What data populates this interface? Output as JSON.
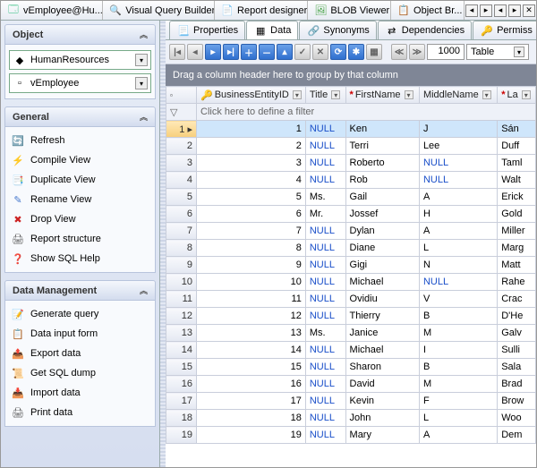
{
  "top_tabs": [
    {
      "label": "vEmployee@Hu...",
      "icon": "🗔",
      "color": "#2b7"
    },
    {
      "label": "Visual Query Builder",
      "icon": "🔍",
      "color": "#36c"
    },
    {
      "label": "Report designer",
      "icon": "📄",
      "color": "#c63"
    },
    {
      "label": "BLOB Viewer",
      "icon": "🖼",
      "color": "#393"
    },
    {
      "label": "Object Br...",
      "icon": "📋",
      "color": "#36c"
    }
  ],
  "object_panel": {
    "title": "Object",
    "schema": "HumanResources",
    "view": "vEmployee"
  },
  "general_panel": {
    "title": "General",
    "items": [
      {
        "label": "Refresh",
        "icon": "🔄",
        "color": "#3a7"
      },
      {
        "label": "Compile View",
        "icon": "⚡",
        "color": "#c80"
      },
      {
        "label": "Duplicate View",
        "icon": "📑",
        "color": "#47c"
      },
      {
        "label": "Rename View",
        "icon": "✎",
        "color": "#47c"
      },
      {
        "label": "Drop View",
        "icon": "✖",
        "color": "#c22"
      },
      {
        "label": "Report structure",
        "icon": "🖨",
        "color": "#555"
      },
      {
        "label": "Show SQL Help",
        "icon": "❓",
        "color": "#27c"
      }
    ]
  },
  "data_mgmt_panel": {
    "title": "Data Management",
    "items": [
      {
        "label": "Generate query",
        "icon": "📝",
        "color": "#c80"
      },
      {
        "label": "Data input form",
        "icon": "📋",
        "color": "#47c"
      },
      {
        "label": "Export data",
        "icon": "📤",
        "color": "#3a7"
      },
      {
        "label": "Get SQL dump",
        "icon": "📜",
        "color": "#47c"
      },
      {
        "label": "Import data",
        "icon": "📥",
        "color": "#c44"
      },
      {
        "label": "Print data",
        "icon": "🖨",
        "color": "#555"
      }
    ]
  },
  "sub_tabs": [
    {
      "label": "Properties",
      "icon": "📃"
    },
    {
      "label": "Data",
      "icon": "▦",
      "active": true
    },
    {
      "label": "Synonyms",
      "icon": "🔗"
    },
    {
      "label": "Dependencies",
      "icon": "⇄"
    },
    {
      "label": "Permiss",
      "icon": "🔑"
    }
  ],
  "toolbar": {
    "page_value": "1000",
    "view_mode": "Table"
  },
  "group_hint": "Drag a column header here to group by that column",
  "filter_hint": "Click here to define a filter",
  "columns": [
    {
      "label": "BusinessEntityID",
      "key": true
    },
    {
      "label": "Title",
      "star": false
    },
    {
      "label": "FirstName",
      "star": true
    },
    {
      "label": "MiddleName",
      "star": false
    },
    {
      "label": "La",
      "star": true
    }
  ],
  "rows": [
    {
      "n": 1,
      "id": 1,
      "title": null,
      "first": "Ken",
      "mid": "J",
      "last": "Sán",
      "sel": true
    },
    {
      "n": 2,
      "id": 2,
      "title": null,
      "first": "Terri",
      "mid": "Lee",
      "last": "Duff"
    },
    {
      "n": 3,
      "id": 3,
      "title": null,
      "first": "Roberto",
      "mid": null,
      "last": "Taml"
    },
    {
      "n": 4,
      "id": 4,
      "title": null,
      "first": "Rob",
      "mid": null,
      "last": "Walt"
    },
    {
      "n": 5,
      "id": 5,
      "title": "Ms.",
      "first": "Gail",
      "mid": "A",
      "last": "Erick"
    },
    {
      "n": 6,
      "id": 6,
      "title": "Mr.",
      "first": "Jossef",
      "mid": "H",
      "last": "Gold"
    },
    {
      "n": 7,
      "id": 7,
      "title": null,
      "first": "Dylan",
      "mid": "A",
      "last": "Miller"
    },
    {
      "n": 8,
      "id": 8,
      "title": null,
      "first": "Diane",
      "mid": "L",
      "last": "Marg"
    },
    {
      "n": 9,
      "id": 9,
      "title": null,
      "first": "Gigi",
      "mid": "N",
      "last": "Matt"
    },
    {
      "n": 10,
      "id": 10,
      "title": null,
      "first": "Michael",
      "mid": null,
      "last": "Rahe"
    },
    {
      "n": 11,
      "id": 11,
      "title": null,
      "first": "Ovidiu",
      "mid": "V",
      "last": "Crac"
    },
    {
      "n": 12,
      "id": 12,
      "title": null,
      "first": "Thierry",
      "mid": "B",
      "last": "D'He"
    },
    {
      "n": 13,
      "id": 13,
      "title": "Ms.",
      "first": "Janice",
      "mid": "M",
      "last": "Galv"
    },
    {
      "n": 14,
      "id": 14,
      "title": null,
      "first": "Michael",
      "mid": "I",
      "last": "Sulli"
    },
    {
      "n": 15,
      "id": 15,
      "title": null,
      "first": "Sharon",
      "mid": "B",
      "last": "Sala"
    },
    {
      "n": 16,
      "id": 16,
      "title": null,
      "first": "David",
      "mid": "M",
      "last": "Brad"
    },
    {
      "n": 17,
      "id": 17,
      "title": null,
      "first": "Kevin",
      "mid": "F",
      "last": "Brow"
    },
    {
      "n": 18,
      "id": 18,
      "title": null,
      "first": "John",
      "mid": "L",
      "last": "Woo"
    },
    {
      "n": 19,
      "id": 19,
      "title": null,
      "first": "Mary",
      "mid": "A",
      "last": "Dem"
    }
  ]
}
